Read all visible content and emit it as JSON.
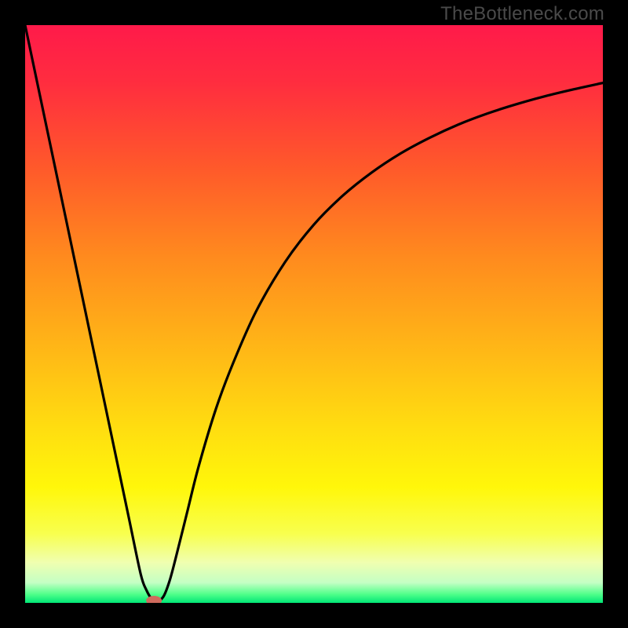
{
  "watermark": "TheBottleneck.com",
  "chart_data": {
    "type": "line",
    "title": "",
    "xlabel": "",
    "ylabel": "",
    "xlim": [
      0,
      100
    ],
    "ylim": [
      0,
      100
    ],
    "gradient_stops": [
      {
        "offset": 0.0,
        "color": "#ff1a4a"
      },
      {
        "offset": 0.1,
        "color": "#ff2d3f"
      },
      {
        "offset": 0.25,
        "color": "#ff5a2a"
      },
      {
        "offset": 0.4,
        "color": "#ff8a1e"
      },
      {
        "offset": 0.55,
        "color": "#ffb417"
      },
      {
        "offset": 0.7,
        "color": "#ffde10"
      },
      {
        "offset": 0.8,
        "color": "#fff70a"
      },
      {
        "offset": 0.88,
        "color": "#f8ff4e"
      },
      {
        "offset": 0.93,
        "color": "#f0ffb0"
      },
      {
        "offset": 0.965,
        "color": "#c4ffc4"
      },
      {
        "offset": 0.985,
        "color": "#50ff8a"
      },
      {
        "offset": 1.0,
        "color": "#00e676"
      }
    ],
    "series": [
      {
        "name": "curve",
        "x": [
          0,
          2,
          4,
          6,
          8,
          10,
          12,
          14,
          16,
          18,
          20,
          21,
          22,
          23,
          24,
          25,
          26,
          28,
          30,
          33,
          36,
          40,
          45,
          50,
          55,
          60,
          65,
          70,
          75,
          80,
          85,
          90,
          95,
          100
        ],
        "y": [
          100,
          90.5,
          81,
          71.5,
          62,
          52.5,
          43,
          33.5,
          24,
          14.5,
          5,
          2.2,
          0.6,
          0.3,
          1.2,
          3.8,
          7.5,
          15.5,
          23.5,
          33.5,
          41.5,
          50.5,
          59.0,
          65.5,
          70.5,
          74.5,
          77.8,
          80.5,
          82.8,
          84.7,
          86.3,
          87.7,
          88.9,
          90.0
        ]
      }
    ],
    "marker": {
      "x": 22.3,
      "y": 0.4,
      "color": "#cf6a5d",
      "rx": 10,
      "ry": 6
    }
  }
}
